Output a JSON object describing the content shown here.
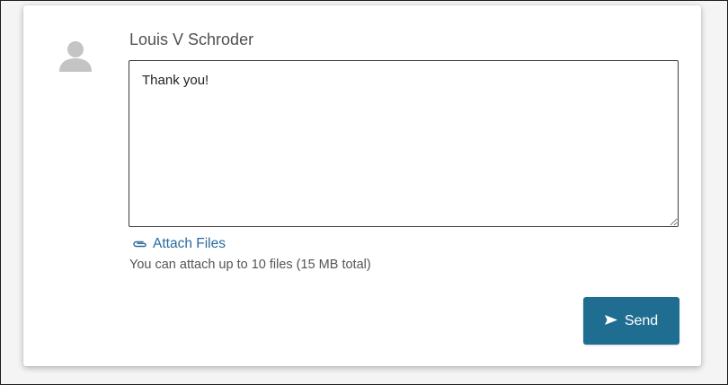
{
  "comment": {
    "author": "Louis V Schroder",
    "message": "Thank you!",
    "attach_label": "Attach Files",
    "attach_help": "You can attach up to 10 files (15 MB total)",
    "send_label": "Send"
  },
  "icons": {
    "avatar": "user-silhouette-icon",
    "attach": "paperclip-icon",
    "send": "send-arrow-icon"
  },
  "colors": {
    "link": "#2a6a9d",
    "button": "#1f6e91",
    "avatar": "#c4c4c4"
  }
}
